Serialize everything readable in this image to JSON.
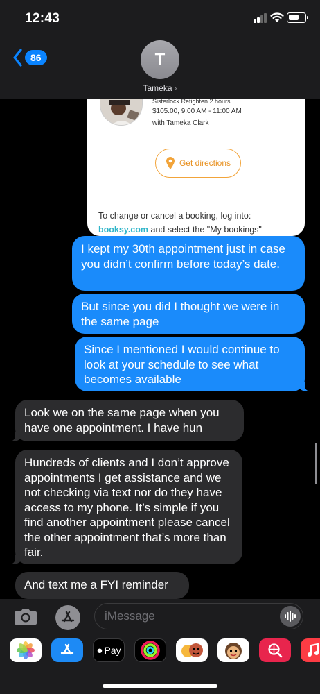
{
  "status": {
    "time": "12:43"
  },
  "header": {
    "unread_count": "86",
    "contact_initial": "T",
    "contact_name": "Tameka"
  },
  "booking_card": {
    "service": "Sisterlock Retighten 2 hours",
    "price_time": "$105.00, 9:00 AM - 11:00 AM",
    "with": "with Tameka Clark",
    "directions_label": "Get directions",
    "footer_line1": "To change or cancel a booking, log into:",
    "footer_link": "booksy.com",
    "footer_rest": " and select the \"My bookings\""
  },
  "messages": [
    {
      "direction": "outgoing",
      "text": "I kept my 30th appointment just in case you didn’t confirm before today’s date."
    },
    {
      "direction": "outgoing",
      "text": "But since you did I thought we were in the same page"
    },
    {
      "direction": "outgoing",
      "text": "Since I mentioned I would continue to look at your schedule to see what becomes available"
    },
    {
      "direction": "incoming",
      "text": "Look we on the same page when you have one appointment. I have hun"
    },
    {
      "direction": "incoming",
      "text": "Hundreds of clients and I don’t approve appointments I get assistance and we not checking via text nor do they have access to my phone. It’s simple if you find another appointment please cancel the other appointment that’s more than fair."
    },
    {
      "direction": "incoming",
      "text": "And text me a FYI reminder"
    }
  ],
  "composer": {
    "placeholder": "iMessage"
  },
  "app_drawer": [
    {
      "name": "photos",
      "icon": "photos-icon"
    },
    {
      "name": "app-store",
      "icon": "app-store-icon"
    },
    {
      "name": "apple-pay",
      "icon": "apple-pay-icon",
      "label": "Pay"
    },
    {
      "name": "activity",
      "icon": "activity-icon"
    },
    {
      "name": "memoji-stickers",
      "icon": "memoji-icon"
    },
    {
      "name": "animoji",
      "icon": "animoji-icon"
    },
    {
      "name": "web-search",
      "icon": "search-globe-icon"
    },
    {
      "name": "music",
      "icon": "music-icon"
    }
  ],
  "colors": {
    "outgoing_bubble": "#1a8bfb",
    "incoming_bubble": "#2c2c2e",
    "accent": "#0a84ff",
    "directions_orange": "#f2a43a"
  }
}
